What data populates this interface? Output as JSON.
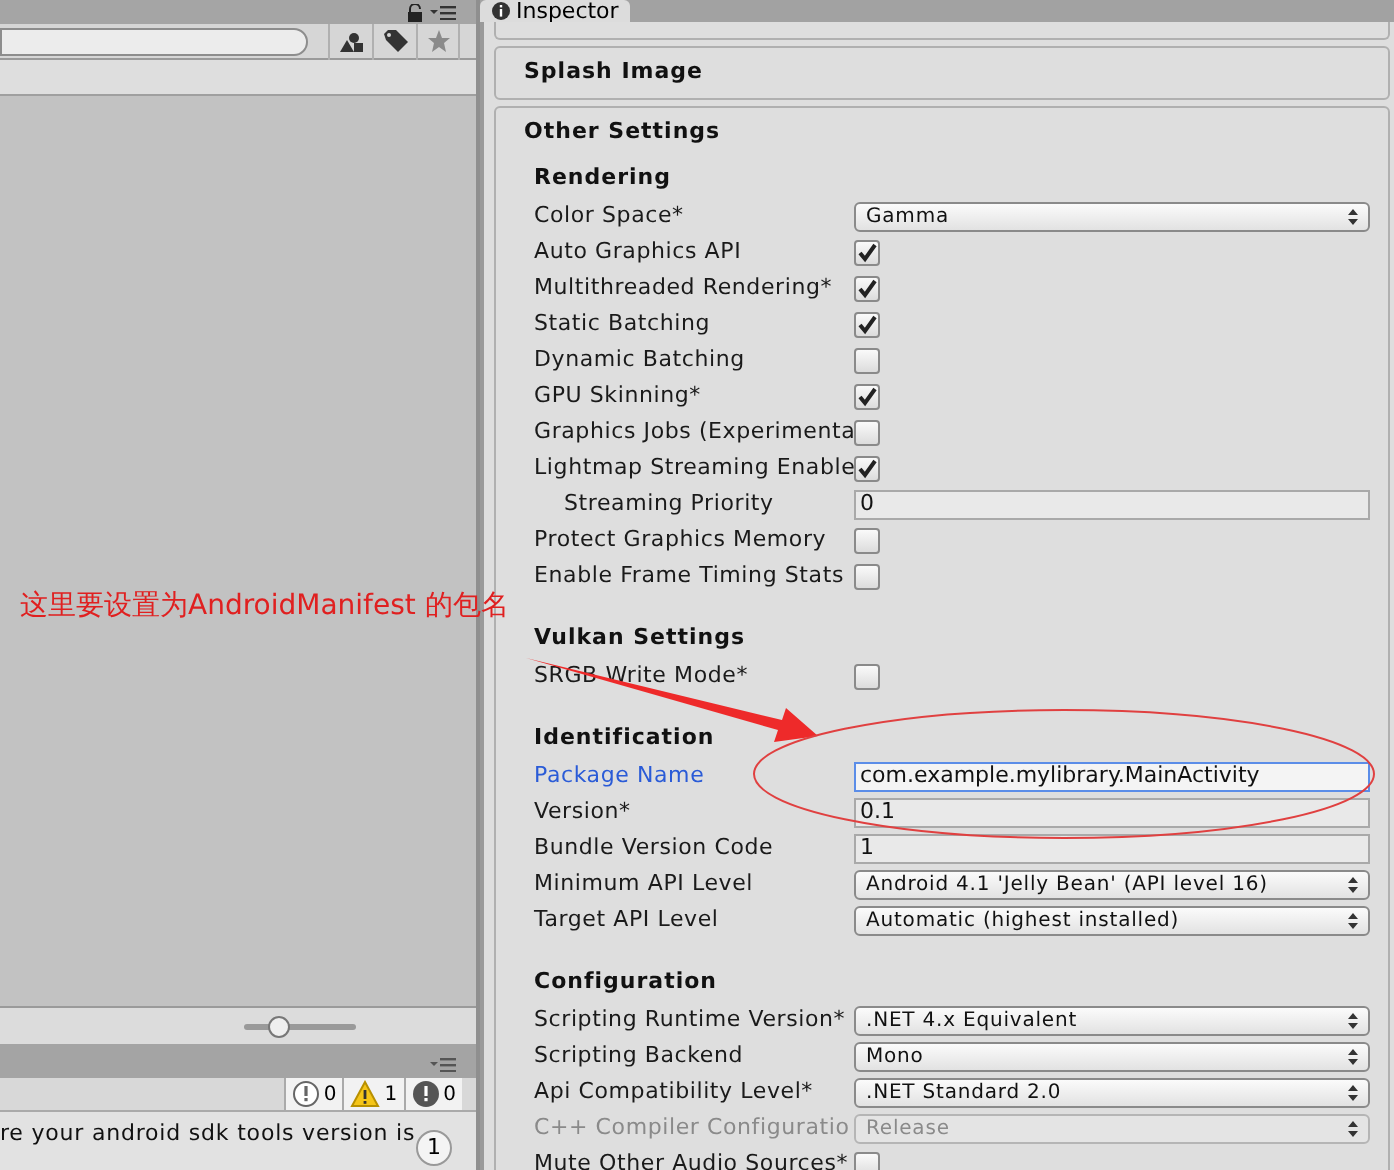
{
  "left_panel": {
    "counts": [
      {
        "kind": "info",
        "count": "0"
      },
      {
        "kind": "warning",
        "count": "1"
      },
      {
        "kind": "error",
        "count": "0"
      }
    ],
    "console_message": "re your android sdk tools version is",
    "badge": "1",
    "zoom_slider": {
      "level": 0.3
    }
  },
  "annotation": {
    "text": "这里要设置为AndroidManifest 的包名"
  },
  "inspector": {
    "tab": "Inspector",
    "sections": [
      {
        "title": "Splash Image"
      },
      {
        "title": "Other Settings"
      }
    ],
    "groups": [
      {
        "title": "Rendering",
        "rows": [
          {
            "kind": "dropdown",
            "label": "Color Space*",
            "value": "Gamma"
          },
          {
            "kind": "checkbox",
            "label": "Auto Graphics API",
            "checked": true
          },
          {
            "kind": "checkbox",
            "label": "Multithreaded Rendering*",
            "checked": true
          },
          {
            "kind": "checkbox",
            "label": "Static Batching",
            "checked": true
          },
          {
            "kind": "checkbox",
            "label": "Dynamic Batching",
            "checked": false
          },
          {
            "kind": "checkbox",
            "label": "GPU Skinning*",
            "checked": true
          },
          {
            "kind": "checkbox",
            "label": "Graphics Jobs (Experimenta",
            "checked": false
          },
          {
            "kind": "checkbox",
            "label": "Lightmap Streaming Enable",
            "checked": true,
            "children": [
              {
                "kind": "field",
                "label": "Streaming Priority",
                "value": "0"
              }
            ]
          },
          {
            "kind": "checkbox",
            "label": "Protect Graphics Memory",
            "checked": false
          },
          {
            "kind": "checkbox",
            "label": "Enable Frame Timing Stats",
            "checked": false
          }
        ]
      },
      {
        "title": "Vulkan Settings",
        "rows": [
          {
            "kind": "checkbox",
            "label": "SRGB Write Mode*",
            "checked": false
          }
        ]
      },
      {
        "title": "Identification",
        "rows": [
          {
            "kind": "field",
            "label": "Package Name",
            "value": "com.example.mylibrary.MainActivity",
            "focused": true
          },
          {
            "kind": "field",
            "label": "Version*",
            "value": "0.1"
          },
          {
            "kind": "field",
            "label": "Bundle Version Code",
            "value": "1"
          },
          {
            "kind": "dropdown",
            "label": "Minimum API Level",
            "value": "Android 4.1 'Jelly Bean' (API level 16)"
          },
          {
            "kind": "dropdown",
            "label": "Target API Level",
            "value": "Automatic (highest installed)"
          }
        ]
      },
      {
        "title": "Configuration",
        "rows": [
          {
            "kind": "dropdown",
            "label": "Scripting Runtime Version*",
            "value": ".NET 4.x Equivalent"
          },
          {
            "kind": "dropdown",
            "label": "Scripting Backend",
            "value": "Mono"
          },
          {
            "kind": "dropdown",
            "label": "Api Compatibility Level*",
            "value": ".NET Standard 2.0"
          },
          {
            "kind": "dropdown",
            "label": "C++ Compiler Configuratio",
            "value": "Release",
            "disabled": true
          },
          {
            "kind": "checkbox",
            "label": "Mute Other Audio Sources*",
            "checked": false
          }
        ]
      }
    ]
  }
}
